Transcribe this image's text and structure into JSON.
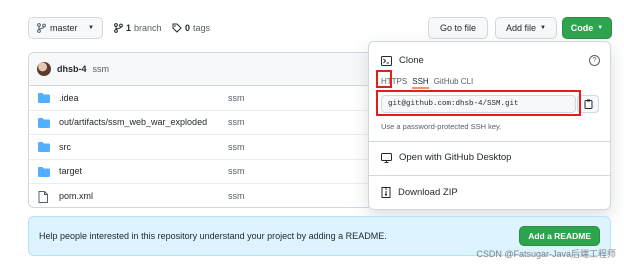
{
  "toolbar": {
    "branch_button": "master",
    "branch_count": "1",
    "branch_word": "branch",
    "tag_count": "0",
    "tag_word": "tags",
    "go_to_file": "Go to file",
    "add_file": "Add file",
    "code": "Code"
  },
  "commit": {
    "author": "dhsb-4",
    "message": "ssm"
  },
  "files": [
    {
      "name": ".idea",
      "message": "ssm",
      "icon": "folder-icon"
    },
    {
      "name": "out/artifacts/ssm_web_war_exploded",
      "message": "ssm",
      "icon": "folder-icon"
    },
    {
      "name": "src",
      "message": "ssm",
      "icon": "folder-icon"
    },
    {
      "name": "target",
      "message": "ssm",
      "icon": "folder-icon"
    },
    {
      "name": "pom.xml",
      "message": "ssm",
      "icon": "file-icon"
    }
  ],
  "clone": {
    "title": "Clone",
    "help": "?",
    "tabs": [
      "HTTPS",
      "SSH",
      "GitHub CLI"
    ],
    "active_tab": "SSH",
    "url": "git@github.com:dhsb-4/SSM.git",
    "note": "Use a password-protected SSH key.",
    "open_desktop": "Open with GitHub Desktop",
    "download_zip": "Download ZIP"
  },
  "readme": {
    "text": "Help people interested in this repository understand your project by adding a README.",
    "button": "Add a README"
  },
  "watermark": "CSDN @Fatsugar-Java后端工程师",
  "colors": {
    "accent_green": "#2da44e",
    "highlight_red": "#e0201a",
    "folder_blue": "#54aeff",
    "readme_bg": "#ddf4ff"
  }
}
